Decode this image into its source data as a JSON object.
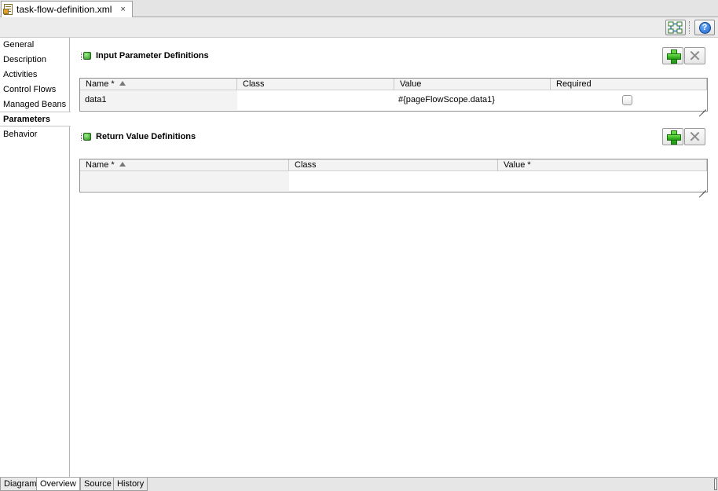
{
  "editor_tab": {
    "title": "task-flow-definition.xml",
    "close": "×"
  },
  "toolbar": {
    "help_label": "?"
  },
  "nav": {
    "items": [
      {
        "label": "General"
      },
      {
        "label": "Description"
      },
      {
        "label": "Activities"
      },
      {
        "label": "Control Flows"
      },
      {
        "label": "Managed Beans"
      },
      {
        "label": "Parameters"
      },
      {
        "label": "Behavior"
      }
    ],
    "active": "Parameters"
  },
  "input_params": {
    "title": "Input Parameter Definitions",
    "columns": [
      "Name *",
      "Class",
      "Value",
      "Required"
    ],
    "rows": [
      {
        "name": "data1",
        "class": "",
        "value": "#{pageFlowScope.data1}",
        "required": false
      }
    ]
  },
  "return_values": {
    "title": "Return Value Definitions",
    "columns": [
      "Name *",
      "Class",
      "Value *"
    ],
    "rows": []
  },
  "bottom_tabs": {
    "items": [
      {
        "label": "Diagram"
      },
      {
        "label": "Overview"
      },
      {
        "label": "Source"
      },
      {
        "label": "History"
      }
    ],
    "active": "Overview"
  }
}
